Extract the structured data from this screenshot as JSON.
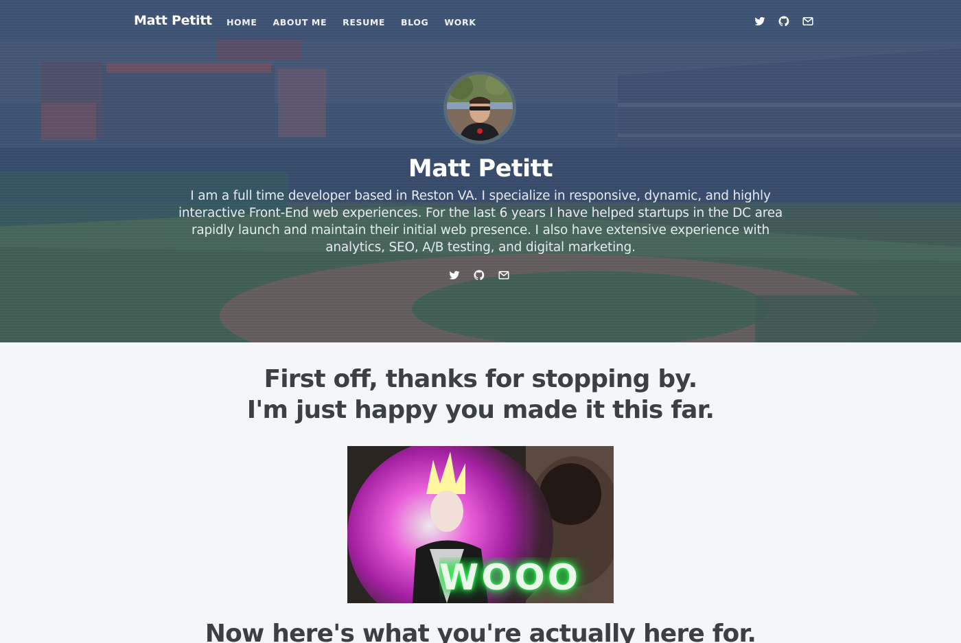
{
  "nav": {
    "brand": "Matt Petitt",
    "links": [
      {
        "label": "HOME"
      },
      {
        "label": "ABOUT ME"
      },
      {
        "label": "RESUME"
      },
      {
        "label": "BLOG"
      },
      {
        "label": "WORK"
      }
    ],
    "icons": [
      "twitter-icon",
      "github-icon",
      "mail-icon"
    ]
  },
  "hero": {
    "name": "Matt Petitt",
    "bio": "I am a full time developer based in Reston VA. I specialize in responsive, dynamic, and highly interactive Front-End web experiences. For the last 6 years I have helped startups in the DC area rapidly launch and maintain their initial web presence. I also have extensive experience with analytics, SEO, A/B testing, and digital marketing.",
    "icons": [
      "twitter-icon",
      "github-icon",
      "mail-icon"
    ]
  },
  "main": {
    "headline_line1": "First off, thanks for stopping by.",
    "headline_line2": "I'm just happy you made it this far.",
    "gif_text": "WOOO",
    "subheadline": "Now here's what you're actually here for."
  },
  "colors": {
    "text_dark": "#3b4045",
    "page_bg": "#f4f6f9",
    "gif_glow": "#33ff55"
  }
}
